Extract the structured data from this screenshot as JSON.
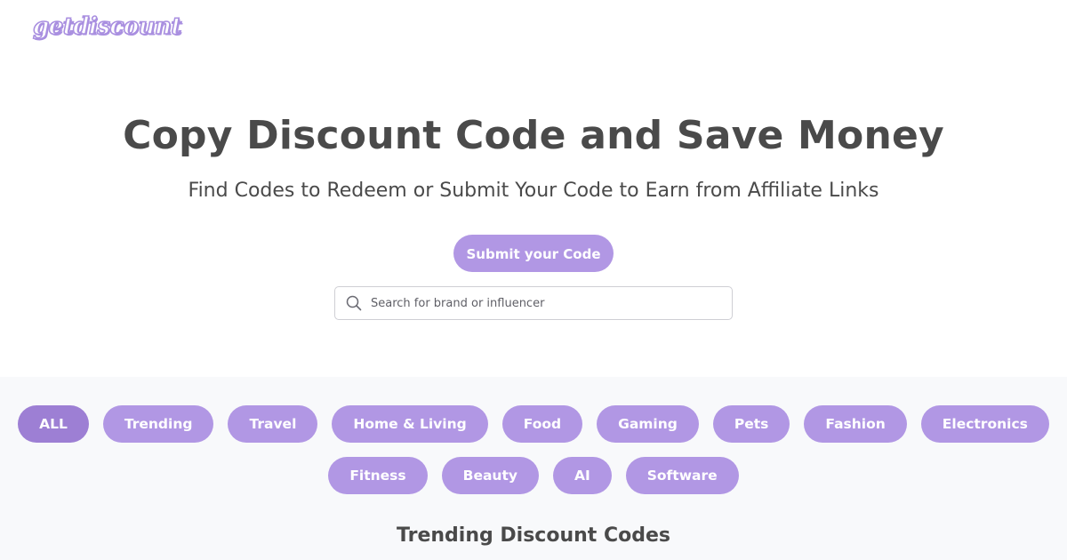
{
  "brand": {
    "logo_text": "getdiscount"
  },
  "hero": {
    "title": "Copy Discount Code and Save Money",
    "subtitle": "Find Codes to Redeem or Submit Your Code to Earn from Affiliate Links",
    "submit_label": "Submit your Code",
    "search_placeholder": "Search for brand or influencer",
    "search_value": ""
  },
  "categories": {
    "row1": [
      "ALL",
      "Trending",
      "Travel",
      "Home & Living",
      "Food",
      "Gaming",
      "Pets",
      "Fashion",
      "Electronics"
    ],
    "row2": [
      "Fitness",
      "Beauty",
      "AI",
      "Software"
    ],
    "active": "ALL"
  },
  "trending": {
    "title": "Trending Discount Codes"
  },
  "colors": {
    "accent": "#b197e4",
    "accent_active": "#9d7fd4",
    "text": "#4a4a4a",
    "section_bg": "#f8f9fb"
  },
  "icons": {
    "search": "search-icon"
  }
}
